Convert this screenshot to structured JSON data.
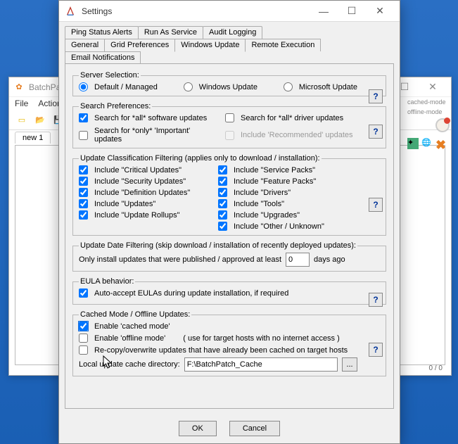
{
  "back_window": {
    "title": "BatchPatch",
    "menu": [
      "File",
      "Actions"
    ],
    "tab": "new 1",
    "status": "0 / 0",
    "side_labels": [
      "cached-mode",
      "offline-mode"
    ]
  },
  "dialog": {
    "title": "Settings",
    "tabs_row1": [
      "Ping Status Alerts",
      "Run As Service",
      "Audit Logging"
    ],
    "tabs_row2": [
      "General",
      "Grid Preferences",
      "Windows Update",
      "Remote Execution",
      "Email Notifications"
    ],
    "active_tab": "Windows Update"
  },
  "server_selection": {
    "legend": "Server Selection:",
    "options": {
      "default": "Default / Managed",
      "wu": "Windows Update",
      "mu": "Microsoft Update"
    }
  },
  "search_prefs": {
    "legend": "Search Preferences:",
    "all_software": "Search for *all* software updates",
    "all_driver": "Search for *all* driver updates",
    "only_important": "Search for *only* 'Important' updates",
    "include_recommended": "Include 'Recommended' updates"
  },
  "classification": {
    "legend": "Update Classification Filtering (applies only to download / installation):",
    "left": {
      "critical": "Include \"Critical Updates\"",
      "security": "Include \"Security Updates\"",
      "definition": "Include \"Definition Updates\"",
      "updates": "Include \"Updates\"",
      "rollups": "Include \"Update Rollups\""
    },
    "right": {
      "service_packs": "Include \"Service Packs\"",
      "feature_packs": "Include \"Feature Packs\"",
      "drivers": "Include \"Drivers\"",
      "tools": "Include \"Tools\"",
      "upgrades": "Include \"Upgrades\"",
      "other": "Include \"Other / Unknown\""
    }
  },
  "date_filtering": {
    "legend": "Update Date Filtering (skip download / installation of recently deployed updates):",
    "label_pre": "Only install updates that were published / approved at least",
    "value": "0",
    "label_post": "days ago"
  },
  "eula": {
    "legend": "EULA behavior:",
    "auto_accept": "Auto-accept EULAs during update installation, if required"
  },
  "cached": {
    "legend": "Cached Mode / Offline Updates:",
    "enable_cached": "Enable 'cached mode'",
    "enable_offline": "Enable 'offline mode'",
    "offline_note": "( use for target hosts with no internet access )",
    "recopy": "Re-copy/overwrite updates that have already been cached on target hosts",
    "cache_dir_label": "Local update cache directory:",
    "cache_dir_value": "F:\\BatchPatch_Cache"
  },
  "buttons": {
    "ok": "OK",
    "cancel": "Cancel",
    "help": "?"
  }
}
